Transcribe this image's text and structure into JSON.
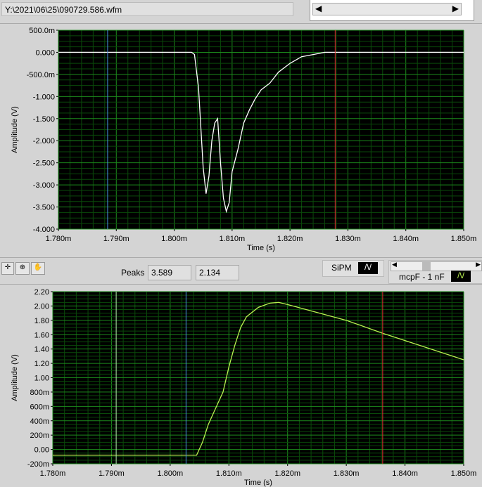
{
  "file_path": "Y:\\2021\\06\\25\\090729.586.wfm",
  "toolbar": {
    "icons": [
      "cursor-tool-icon",
      "zoom-icon",
      "pan-hand-icon"
    ],
    "peaks_label": "Peaks",
    "peak1": "3.589",
    "peak2": "2.134",
    "plot1_legend": "SiPM",
    "plot2_legend": "mcpF - 1 nF"
  },
  "chart_data": [
    {
      "type": "line",
      "xlabel": "Time (s)",
      "ylabel": "Amplitude (V)",
      "xlim": [
        0.00178,
        0.00185
      ],
      "ylim": [
        -4.0,
        0.5
      ],
      "grid": true,
      "xticks": [
        "1.780m",
        "1.790m",
        "1.800m",
        "1.810m",
        "1.820m",
        "1.830m",
        "1.840m",
        "1.850m"
      ],
      "yticks": [
        "500.0m",
        "0.000",
        "-500.0m",
        "-1.000",
        "-1.500",
        "-2.000",
        "-2.500",
        "-3.000",
        "-3.500",
        "-4.000"
      ],
      "line_color": "#ffffff",
      "cursors": [
        {
          "x": 0.0017885,
          "color": "#4a90e2"
        },
        {
          "x": 0.0018278,
          "color": "#e03030"
        }
      ],
      "x": [
        1.78,
        1.803,
        1.8035,
        1.8042,
        1.805,
        1.8055,
        1.806,
        1.8065,
        1.807,
        1.8075,
        1.808,
        1.8085,
        1.809,
        1.8095,
        1.81,
        1.811,
        1.812,
        1.813,
        1.814,
        1.815,
        1.8165,
        1.818,
        1.82,
        1.822,
        1.824,
        1.826,
        1.85
      ],
      "y": [
        0,
        0,
        -0.05,
        -0.8,
        -2.6,
        -3.2,
        -2.8,
        -2.0,
        -1.6,
        -1.5,
        -2.5,
        -3.3,
        -3.6,
        -3.4,
        -2.7,
        -2.2,
        -1.6,
        -1.3,
        -1.05,
        -0.85,
        -0.7,
        -0.45,
        -0.25,
        -0.1,
        -0.05,
        0,
        0
      ]
    },
    {
      "type": "line",
      "xlabel": "Time (s)",
      "ylabel": "Amplitude (V)",
      "xlim": [
        0.00178,
        0.00185
      ],
      "ylim": [
        -0.2,
        2.2
      ],
      "grid": true,
      "xticks": [
        "1.780m",
        "1.790m",
        "1.800m",
        "1.810m",
        "1.820m",
        "1.830m",
        "1.840m",
        "1.850m"
      ],
      "yticks": [
        "2.20",
        "2.00",
        "1.80",
        "1.60",
        "1.40",
        "1.20",
        "1.00",
        "800m",
        "600m",
        "400m",
        "200m",
        "0.00",
        "-200m"
      ],
      "line_color": "#b8f050",
      "cursors": [
        {
          "x": 0.0017908,
          "color": "#b8f0b0"
        },
        {
          "x": 0.0018027,
          "color": "#4a90e2"
        },
        {
          "x": 0.0018362,
          "color": "#e03030"
        }
      ],
      "x": [
        1.78,
        1.8045,
        1.8055,
        1.8065,
        1.808,
        1.809,
        1.81,
        1.811,
        1.812,
        1.813,
        1.815,
        1.817,
        1.8185,
        1.82,
        1.83,
        1.8362,
        1.85
      ],
      "y": [
        -0.08,
        -0.08,
        0.1,
        0.35,
        0.62,
        0.8,
        1.15,
        1.45,
        1.7,
        1.85,
        1.98,
        2.04,
        2.05,
        2.02,
        1.8,
        1.62,
        1.25
      ]
    }
  ]
}
